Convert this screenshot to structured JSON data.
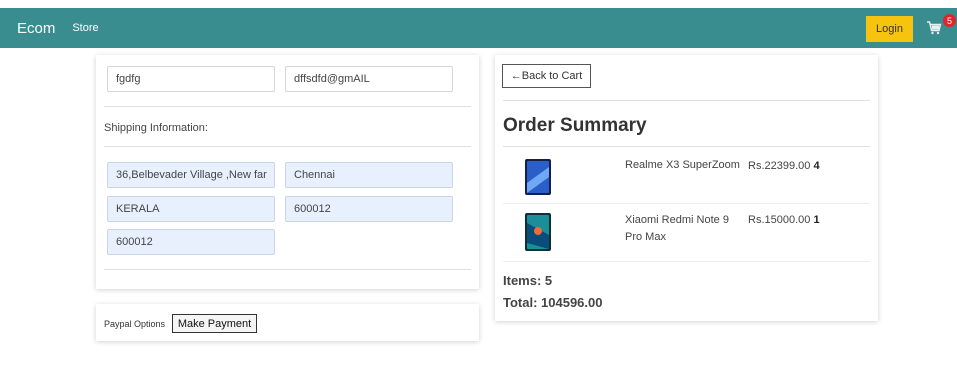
{
  "navbar": {
    "brand": "Ecom",
    "store_link": "Store",
    "login_label": "Login",
    "cart_count": "5"
  },
  "form": {
    "name_value": "fgdfg",
    "email_value": "dffsdfd@gmAIL",
    "shipping_heading": "Shipping Information:",
    "address_value": "36,Belbevader Village ,New far",
    "city_value": "Chennai",
    "state_value": "KERALA",
    "zipcode_value": "600012",
    "country_value": "600012"
  },
  "payment": {
    "options_label": "Paypal Options",
    "make_payment_label": "Make Payment"
  },
  "summary": {
    "back_label": "←Back to Cart",
    "title": "Order Summary",
    "items": [
      {
        "name": "Realme X3 SuperZoom",
        "price": "Rs.22399.00",
        "qty": "4"
      },
      {
        "name": "Xiaomi Redmi Note 9 Pro Max",
        "price": "Rs.15000.00",
        "qty": "1"
      }
    ],
    "items_label": "Items: 5",
    "total_label": "Total: 104596.00"
  },
  "colors": {
    "navbar": "#3a8d8f",
    "login": "#f6c30f",
    "badge": "#e3242b"
  }
}
